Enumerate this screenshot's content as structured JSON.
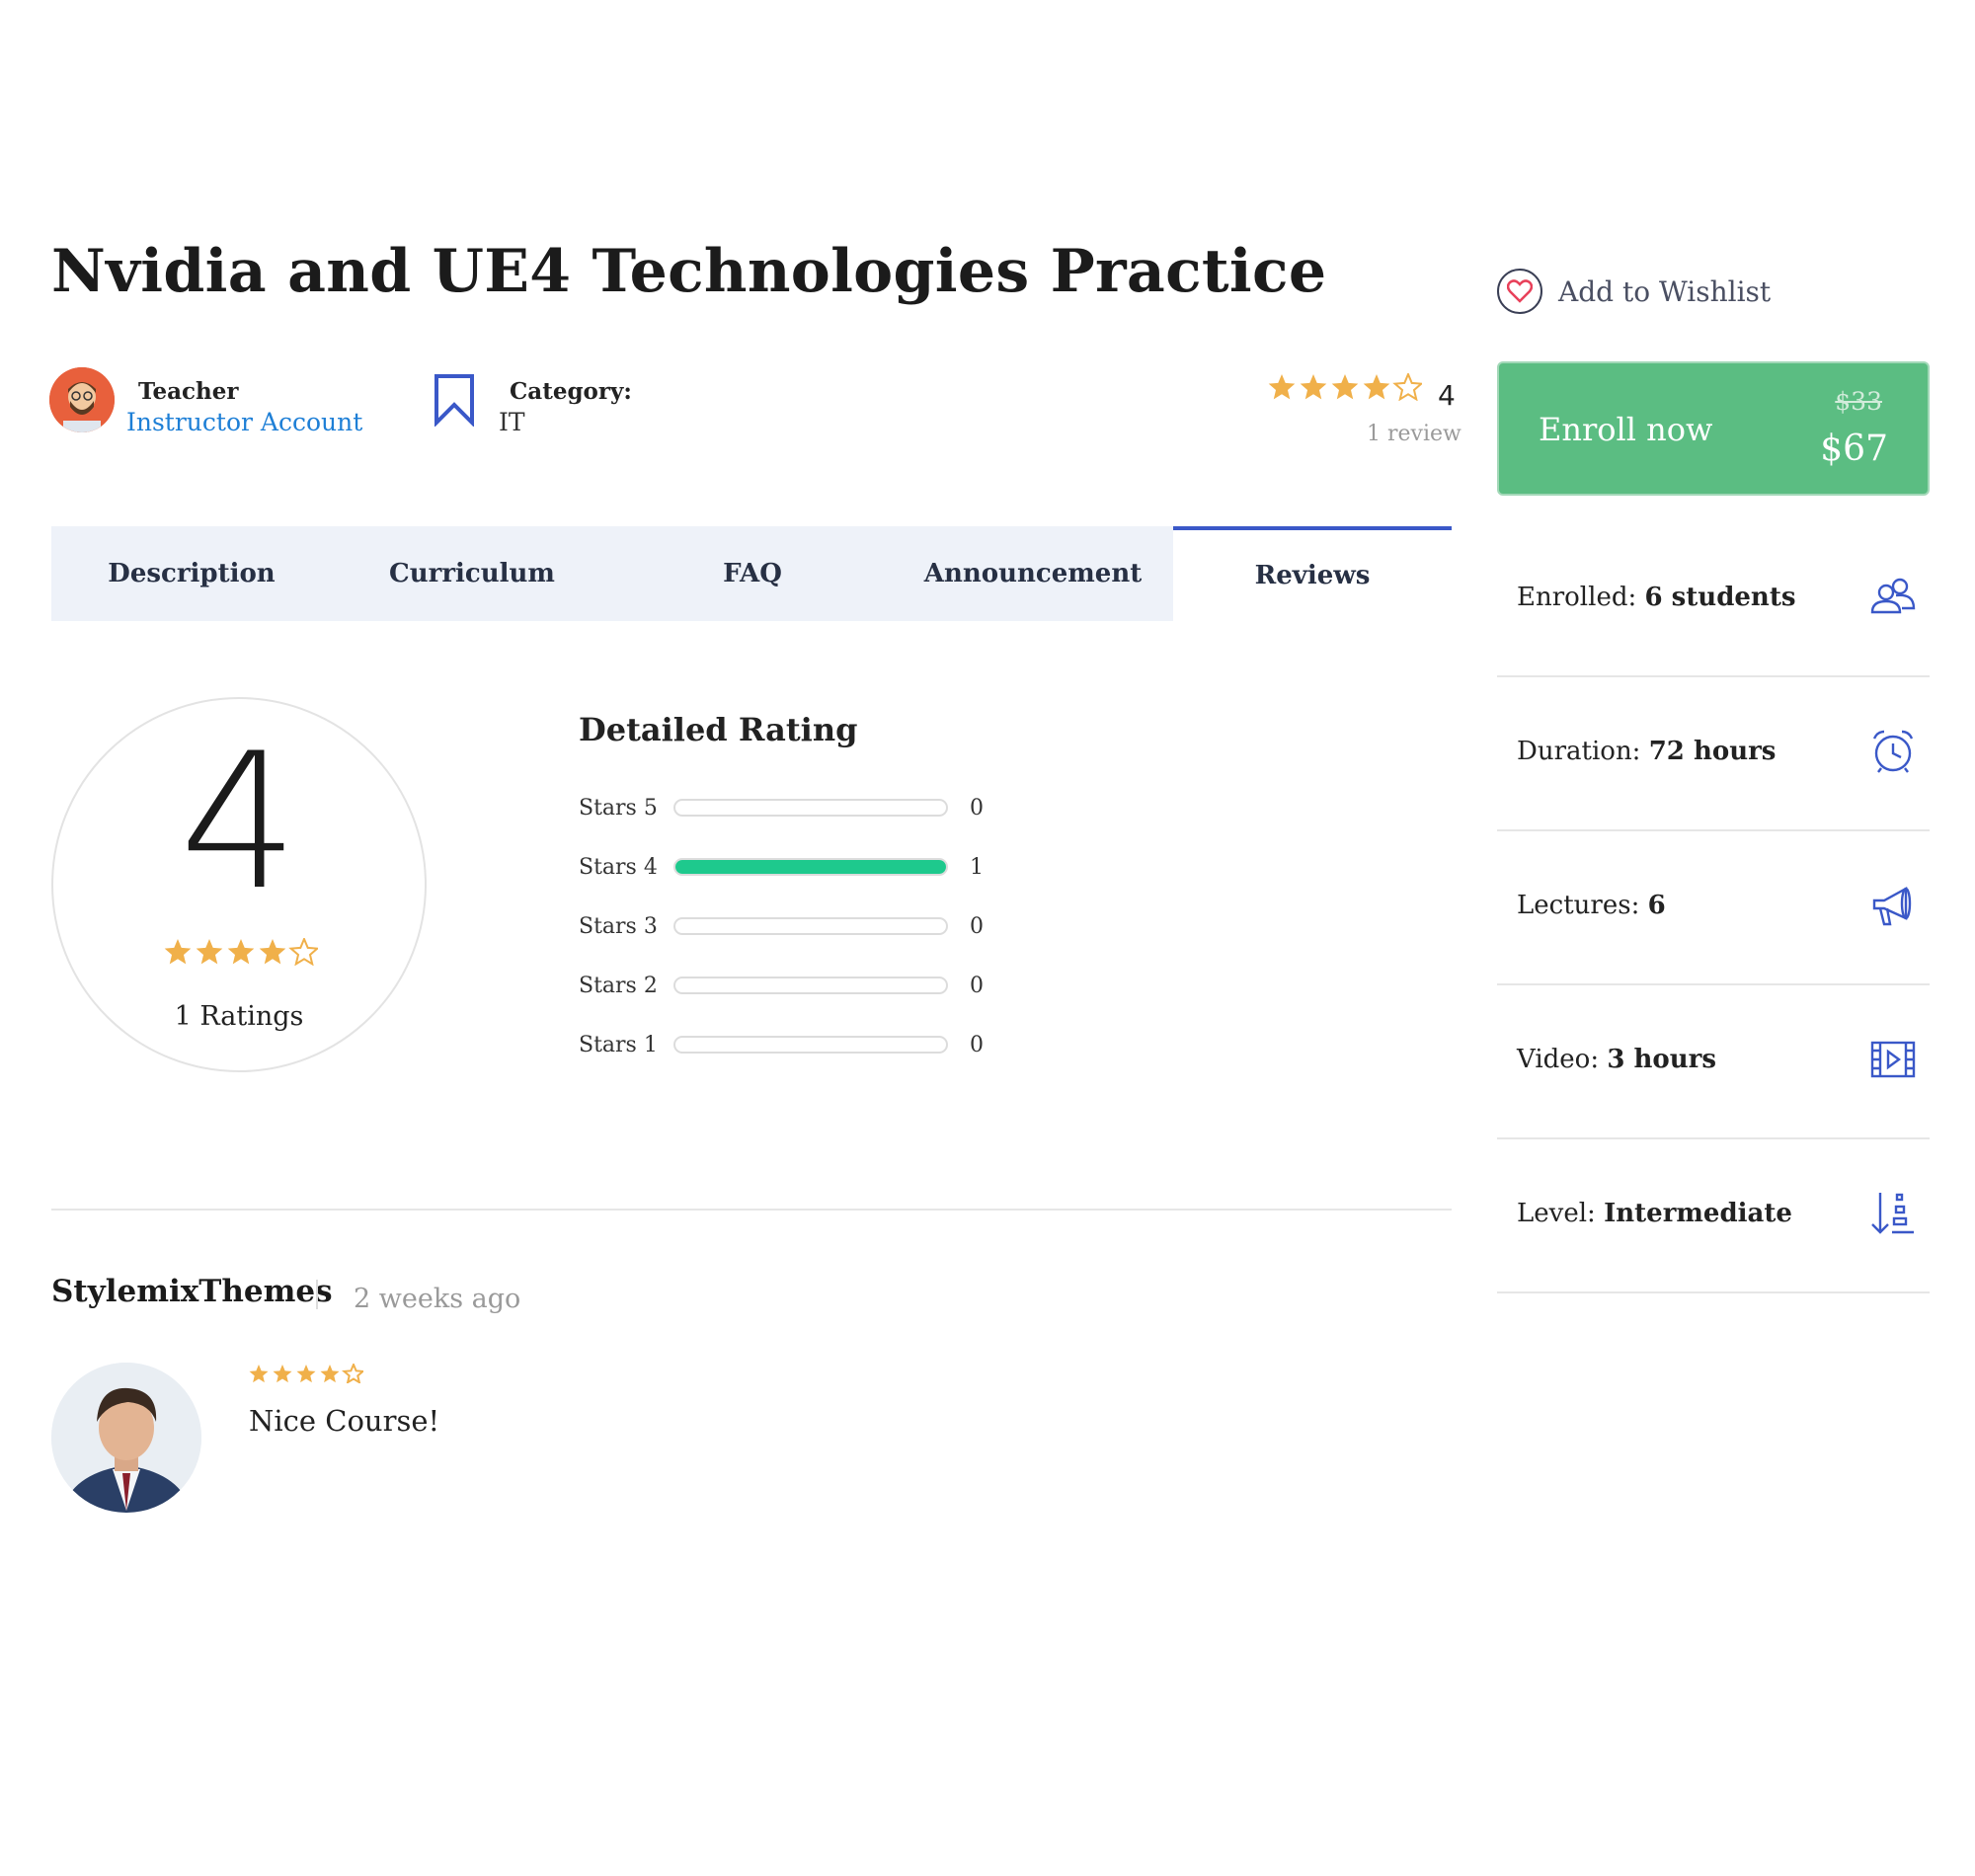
{
  "course": {
    "title": "Nvidia and UE4 Technologies Practice",
    "teacher_label": "Teacher",
    "teacher_name": "Instructor Account",
    "category_label": "Category:",
    "category_value": "IT",
    "rating_value": "4",
    "rating_stars": 4,
    "review_count": "1 review"
  },
  "tabs": [
    {
      "label": "Description",
      "active": false
    },
    {
      "label": "Curriculum",
      "active": false
    },
    {
      "label": "FAQ",
      "active": false
    },
    {
      "label": "Announcement",
      "active": false
    },
    {
      "label": "Reviews",
      "active": true
    }
  ],
  "reviews_summary": {
    "average": "4",
    "stars": 4,
    "ratings_label": "1 Ratings",
    "detailed_title": "Detailed Rating",
    "rows": [
      {
        "label": "Stars 5",
        "count": "0",
        "fraction": 0
      },
      {
        "label": "Stars 4",
        "count": "1",
        "fraction": 1
      },
      {
        "label": "Stars 3",
        "count": "0",
        "fraction": 0
      },
      {
        "label": "Stars 2",
        "count": "0",
        "fraction": 0
      },
      {
        "label": "Stars 1",
        "count": "0",
        "fraction": 0
      }
    ]
  },
  "review": {
    "author": "StylemixThemes",
    "date": "2 weeks ago",
    "stars": 4,
    "text": "Nice Course!"
  },
  "sidebar": {
    "wishlist_label": "Add to Wishlist",
    "enroll_label": "Enroll now",
    "old_price": "$33",
    "price": "$67",
    "info": [
      {
        "label": "Enrolled:",
        "value": "6 students",
        "icon": "users-icon"
      },
      {
        "label": "Duration:",
        "value": "72 hours",
        "icon": "alarm-clock-icon"
      },
      {
        "label": "Lectures:",
        "value": "6",
        "icon": "megaphone-icon"
      },
      {
        "label": "Video:",
        "value": "3 hours",
        "icon": "film-icon"
      },
      {
        "label": "Level:",
        "value": "Intermediate",
        "icon": "level-sort-icon"
      }
    ]
  },
  "colors": {
    "accent_blue": "#3a58c8",
    "star": "#f0b04a",
    "enroll_green": "#5bbd82",
    "bar_green": "#1ec98d",
    "link_blue": "#1e7fd6"
  }
}
